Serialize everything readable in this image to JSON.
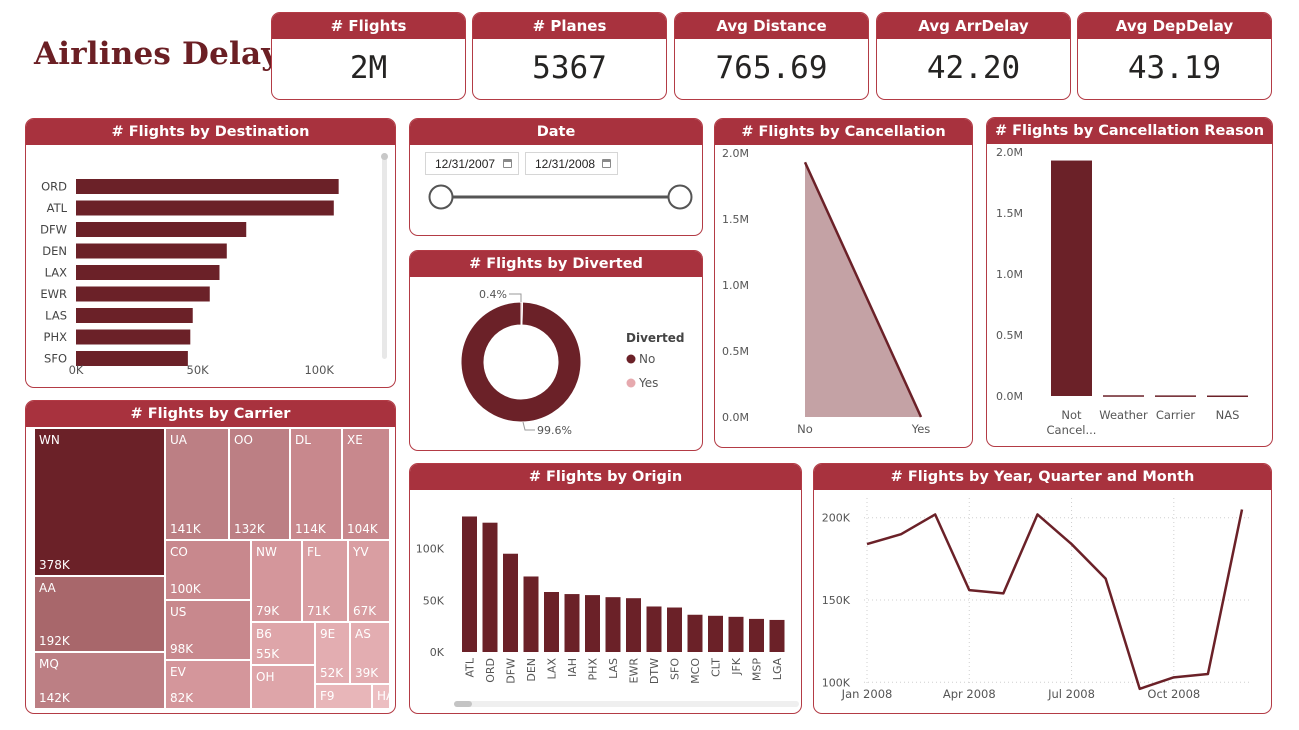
{
  "title": "Airlines Delay",
  "kpis": [
    {
      "label": "# Flights",
      "value": "2M"
    },
    {
      "label": "# Planes",
      "value": "5367"
    },
    {
      "label": "Avg Distance",
      "value": "765.69"
    },
    {
      "label": "Avg ArrDelay",
      "value": "42.20"
    },
    {
      "label": "Avg DepDelay",
      "value": "43.19"
    }
  ],
  "colors": {
    "header": "#a8323e",
    "primary": "#6b2128",
    "area_fill": "#c4a2a5",
    "pie_no": "#6b2128",
    "pie_yes": "#e6a9ae"
  },
  "date_filter": {
    "title": "Date",
    "start": "12/31/2007",
    "end": "12/31/2008",
    "range_fraction": [
      0,
      1
    ]
  },
  "chart_data": [
    {
      "id": "destination",
      "type": "bar",
      "orientation": "horizontal",
      "title": "# Flights by Destination",
      "categories": [
        "ORD",
        "ATL",
        "DFW",
        "DEN",
        "LAX",
        "EWR",
        "LAS",
        "PHX",
        "SFO"
      ],
      "values": [
        108000,
        106000,
        70000,
        62000,
        59000,
        55000,
        48000,
        47000,
        46000
      ],
      "xlim": [
        0,
        125000
      ],
      "xticks": [
        {
          "v": 0,
          "label": "0K"
        },
        {
          "v": 50000,
          "label": "50K"
        },
        {
          "v": 100000,
          "label": "100K"
        }
      ]
    },
    {
      "id": "diverted",
      "type": "pie",
      "donut": true,
      "title": "# Flights by Diverted",
      "legend_title": "Diverted",
      "slices": [
        {
          "label": "No",
          "value": 99.6,
          "data_label": "99.6%"
        },
        {
          "label": "Yes",
          "value": 0.4,
          "data_label": "0.4%"
        }
      ]
    },
    {
      "id": "cancellation",
      "type": "area",
      "title": "# Flights by Cancellation",
      "categories": [
        "No",
        "Yes"
      ],
      "values": [
        1930000,
        0
      ],
      "ylim": [
        0,
        2000000
      ],
      "yticks": [
        {
          "v": 0,
          "label": "0.0M"
        },
        {
          "v": 500000,
          "label": "0.5M"
        },
        {
          "v": 1000000,
          "label": "1.0M"
        },
        {
          "v": 1500000,
          "label": "1.5M"
        },
        {
          "v": 2000000,
          "label": "2.0M"
        }
      ]
    },
    {
      "id": "cancellation_reason",
      "type": "bar",
      "title": "# Flights by Cancellation Reason",
      "categories": [
        "Not Cancel...",
        "Weather",
        "Carrier",
        "NAS"
      ],
      "values": [
        1930000,
        6000,
        5000,
        4000
      ],
      "ylim": [
        0,
        2000000
      ],
      "yticks": [
        {
          "v": 0,
          "label": "0.0M"
        },
        {
          "v": 500000,
          "label": "0.5M"
        },
        {
          "v": 1000000,
          "label": "1.0M"
        },
        {
          "v": 1500000,
          "label": "1.5M"
        },
        {
          "v": 2000000,
          "label": "2.0M"
        }
      ]
    },
    {
      "id": "carrier",
      "type": "treemap",
      "title": "# Flights by Carrier",
      "items": [
        {
          "name": "WN",
          "value": 378000,
          "label": "378K",
          "color": "#6b2128"
        },
        {
          "name": "AA",
          "value": 192000,
          "label": "192K",
          "color": "#a8676b"
        },
        {
          "name": "MQ",
          "value": 142000,
          "label": "142K",
          "color": "#bc7f84"
        },
        {
          "name": "UA",
          "value": 141000,
          "label": "141K",
          "color": "#bc7f84"
        },
        {
          "name": "OO",
          "value": 132000,
          "label": "132K",
          "color": "#bc7f84"
        },
        {
          "name": "DL",
          "value": 114000,
          "label": "114K",
          "color": "#c8888d"
        },
        {
          "name": "XE",
          "value": 104000,
          "label": "104K",
          "color": "#c8888d"
        },
        {
          "name": "CO",
          "value": 100000,
          "label": "100K",
          "color": "#c8888d"
        },
        {
          "name": "US",
          "value": 98000,
          "label": "98K",
          "color": "#c8888d"
        },
        {
          "name": "EV",
          "value": 82000,
          "label": "82K",
          "color": "#d4969b"
        },
        {
          "name": "NW",
          "value": 79000,
          "label": "79K",
          "color": "#d4969b"
        },
        {
          "name": "FL",
          "value": 71000,
          "label": "71K",
          "color": "#d99ea2"
        },
        {
          "name": "YV",
          "value": 67000,
          "label": "67K",
          "color": "#d99ea2"
        },
        {
          "name": "B6",
          "value": 55000,
          "label": "55K",
          "color": "#dea5a9"
        },
        {
          "name": "OH",
          "value": 53000,
          "label": "",
          "color": "#dea5a9"
        },
        {
          "name": "9E",
          "value": 52000,
          "label": "52K",
          "color": "#e3adb1"
        },
        {
          "name": "AS",
          "value": 39000,
          "label": "39K",
          "color": "#e3adb1"
        },
        {
          "name": "F9",
          "value": 28000,
          "label": "",
          "color": "#e8b6b9"
        },
        {
          "name": "HA",
          "value": 8000,
          "label": "",
          "color": "#ecbec1"
        }
      ]
    },
    {
      "id": "origin",
      "type": "bar",
      "title": "# Flights by Origin",
      "categories": [
        "ATL",
        "ORD",
        "DFW",
        "DEN",
        "LAX",
        "IAH",
        "PHX",
        "LAS",
        "EWR",
        "DTW",
        "SFO",
        "MCO",
        "CLT",
        "JFK",
        "MSP",
        "LGA"
      ],
      "values": [
        131000,
        125000,
        95000,
        73000,
        58000,
        56000,
        55000,
        53000,
        52000,
        44000,
        43000,
        36000,
        35000,
        34000,
        32000,
        31000
      ],
      "ylim": [
        0,
        145000
      ],
      "yticks": [
        {
          "v": 0,
          "label": "0K"
        },
        {
          "v": 50000,
          "label": "50K"
        },
        {
          "v": 100000,
          "label": "100K"
        }
      ]
    },
    {
      "id": "year_quarter_month",
      "type": "line",
      "title": "# Flights by Year, Quarter and Month",
      "x": [
        "2008-01",
        "2008-02",
        "2008-03",
        "2008-04",
        "2008-05",
        "2008-06",
        "2008-07",
        "2008-08",
        "2008-09",
        "2008-10",
        "2008-11",
        "2008-12"
      ],
      "values": [
        184000,
        190000,
        202000,
        156000,
        154000,
        202000,
        184000,
        163000,
        96000,
        103000,
        105000,
        205000
      ],
      "ylim": [
        88000,
        212000
      ],
      "yticks": [
        {
          "v": 100000,
          "label": "100K"
        },
        {
          "v": 150000,
          "label": "150K"
        },
        {
          "v": 200000,
          "label": "200K"
        }
      ],
      "xticks": [
        {
          "i": 0,
          "label": "Jan 2008"
        },
        {
          "i": 3,
          "label": "Apr 2008"
        },
        {
          "i": 6,
          "label": "Jul 2008"
        },
        {
          "i": 9,
          "label": "Oct 2008"
        }
      ]
    }
  ]
}
